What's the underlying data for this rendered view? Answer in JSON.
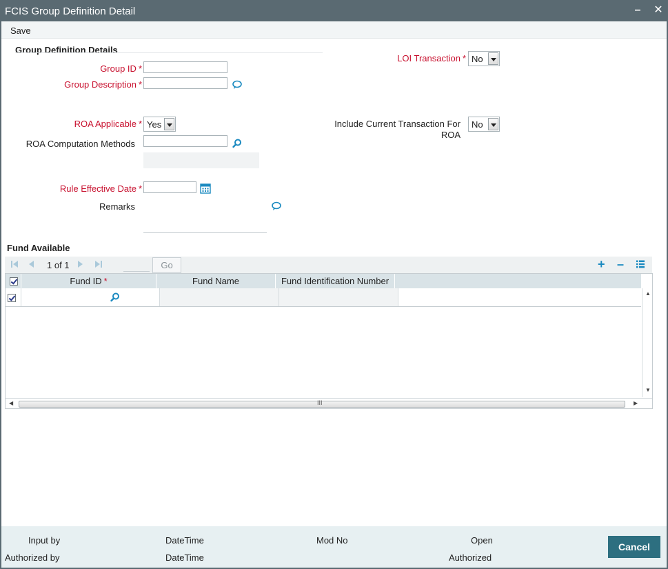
{
  "window": {
    "title": "FCIS Group Definition Detail",
    "minimize_label": "–",
    "close_label": "✕"
  },
  "menu": {
    "save_label": "Save"
  },
  "section": {
    "title": "Group Definition Details"
  },
  "form": {
    "group_id_label": "Group ID",
    "group_description_label": "Group Description",
    "roa_applicable_label": "ROA Applicable",
    "roa_applicable_value": "Yes",
    "roa_computation_label": "ROA Computation Methods",
    "rule_effective_date_label": "Rule Effective Date",
    "remarks_label": "Remarks",
    "loi_transaction_label": "LOI Transaction",
    "loi_transaction_value": "No",
    "include_current_label_line1": "Include Current Transaction For",
    "include_current_label_line2": "ROA",
    "include_current_value": "No",
    "required_marker": "*"
  },
  "fund_available": {
    "title": "Fund Available",
    "pager_text": "1 of 1",
    "go_label": "Go",
    "add_label": "+",
    "remove_label": "–",
    "columns": [
      "Fund ID",
      "Fund Name",
      "Fund Identification Number"
    ],
    "scroll_grip": "III",
    "rows": [
      {
        "checked": true,
        "fund_id": "",
        "fund_name": "",
        "fund_identification_number": ""
      }
    ]
  },
  "footer": {
    "input_by": "Input by",
    "datetime_1": "DateTime",
    "mod_no": "Mod No",
    "open": "Open",
    "authorized_by": "Authorized by",
    "datetime_2": "DateTime",
    "authorized": "Authorized",
    "cancel_label": "Cancel"
  },
  "colors": {
    "titlebar": "#5a6a72",
    "required_label": "#c8102e",
    "icon_blue": "#1b8ac0",
    "grid_header": "#d9e3e7",
    "footer_bg": "#e7f0f2",
    "cancel_button": "#2d6f80"
  }
}
